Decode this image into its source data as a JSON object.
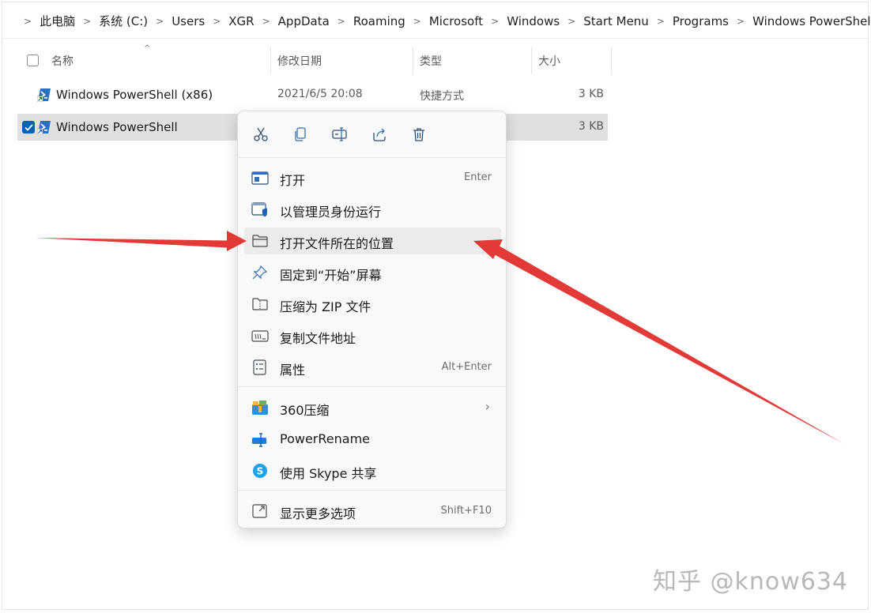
{
  "breadcrumb": {
    "segments": [
      "此电脑",
      "系统 (C:)",
      "Users",
      "XGR",
      "AppData",
      "Roaming",
      "Microsoft",
      "Windows",
      "Start Menu",
      "Programs",
      "Windows PowerShell"
    ]
  },
  "columns": {
    "name": "名称",
    "modified": "修改日期",
    "type": "类型",
    "size": "大小"
  },
  "files": [
    {
      "name": "Windows PowerShell (x86)",
      "modified": "2021/6/5 20:08",
      "type": "快捷方式",
      "size": "3 KB",
      "selected": false
    },
    {
      "name": "Windows PowerShell",
      "modified": "",
      "type": "",
      "size": "3 KB",
      "selected": true
    }
  ],
  "context_menu": {
    "quick_actions": [
      "cut-icon",
      "copy-icon",
      "rename-icon",
      "share-icon",
      "delete-icon"
    ],
    "items": [
      {
        "label": "打开",
        "shortcut": "Enter",
        "icon": "open-window-icon"
      },
      {
        "label": "以管理员身份运行",
        "shortcut": "",
        "icon": "admin-shield-icon"
      },
      {
        "label": "打开文件所在的位置",
        "shortcut": "",
        "icon": "folder-icon",
        "highlighted": true
      },
      {
        "label": "固定到“开始”屏幕",
        "shortcut": "",
        "icon": "pin-icon"
      },
      {
        "label": "压缩为 ZIP 文件",
        "shortcut": "",
        "icon": "zip-folder-icon"
      },
      {
        "label": "复制文件地址",
        "shortcut": "",
        "icon": "copy-path-icon"
      },
      {
        "label": "属性",
        "shortcut": "Alt+Enter",
        "icon": "properties-icon"
      }
    ],
    "app_items": [
      {
        "label": "360压缩",
        "has_submenu": true,
        "icon": "360zip-icon"
      },
      {
        "label": "PowerRename",
        "icon": "powerrename-icon"
      },
      {
        "label": "使用 Skype 共享",
        "icon": "skype-icon"
      }
    ],
    "more": {
      "label": "显示更多选项",
      "shortcut": "Shift+F10",
      "icon": "more-options-icon"
    }
  },
  "watermark": "知乎 @know634",
  "colors": {
    "accent": "#0063b1",
    "arrow": "#e03434",
    "selection": "#e0e0e0"
  }
}
